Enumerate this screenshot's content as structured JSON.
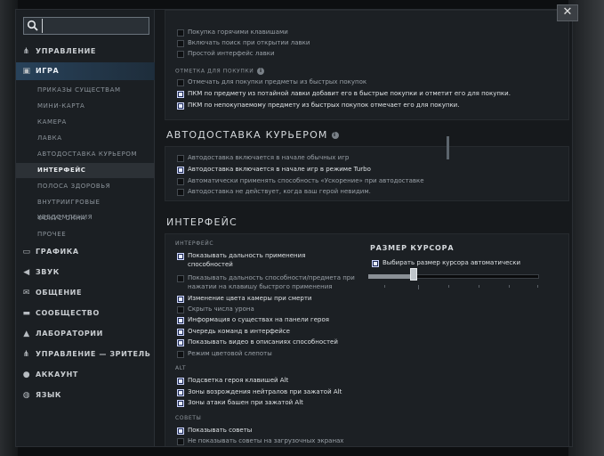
{
  "window": {
    "close_label": "✕"
  },
  "search": {
    "value": "",
    "placeholder": ""
  },
  "sidebar": {
    "categories": [
      {
        "label": "УПРАВЛЕНИЕ",
        "icon": "tree-icon"
      },
      {
        "label": "ИГРА",
        "icon": "game-icon"
      },
      {
        "label": "ГРАФИКА",
        "icon": "monitor-icon"
      },
      {
        "label": "ЗВУК",
        "icon": "speaker-icon"
      },
      {
        "label": "ОБЩЕНИЕ",
        "icon": "chat-icon"
      },
      {
        "label": "СООБЩЕСТВО",
        "icon": "community-icon"
      },
      {
        "label": "ЛАБОРАТОРИИ",
        "icon": "flask-icon"
      },
      {
        "label": "УПРАВЛЕНИЕ — ЗРИТЕЛЬ",
        "icon": "tree-icon"
      },
      {
        "label": "АККАУНТ",
        "icon": "user-icon"
      },
      {
        "label": "ЯЗЫК",
        "icon": "globe-icon"
      }
    ],
    "game_subitems": [
      "ПРИКАЗЫ СУЩЕСТВАМ",
      "МИНИ-КАРТА",
      "КАМЕРА",
      "ЛАВКА",
      "АВТОДОСТАВКА КУРЬЕРОМ",
      "ИНТЕРФЕЙС",
      "ПОЛОСА ЗДОРОВЬЯ",
      "ВНУТРИИГРОВЫЕ УВЕДОМЛЕНИЯ",
      "ФОКУС ОКНА",
      "ПРОЧЕЕ"
    ],
    "active_category": "ИГРА",
    "active_subitem": "ИНТЕРФЕЙС"
  },
  "shop": {
    "options": [
      {
        "label": "Покупка горячими клавишами",
        "checked": false
      },
      {
        "label": "Включать поиск при открытии лавки",
        "checked": false
      },
      {
        "label": "Простой интерфейс лавки",
        "checked": false
      }
    ],
    "buy_mark_header": "ОТМЕТКА ДЛЯ ПОКУПКИ",
    "buy_mark_options": [
      {
        "label": "Отмечать для покупки предметы из быстрых покупок",
        "checked": false
      },
      {
        "label": "ПКМ по предмету из потайной лавки добавит его в быстрые покупки и отметит его для покупки.",
        "checked": true
      },
      {
        "label": "ПКМ по непокупаемому предмету из быстрых покупок отмечает его для покупки.",
        "checked": true
      }
    ]
  },
  "courier": {
    "title": "АВТОДОСТАВКА КУРЬЕРОМ",
    "options": [
      {
        "label": "Автодоставка включается в начале обычных игр",
        "checked": false
      },
      {
        "label": "Автодоставка включается в начале игр в режиме Turbo",
        "checked": true
      },
      {
        "label": "Автоматически применять способность «Ускорение» при автодоставке",
        "checked": false
      },
      {
        "label": "Автодоставка не действует, когда ваш герой невидим.",
        "checked": false
      }
    ]
  },
  "interface": {
    "title": "ИНТЕРФЕЙС",
    "sub_header": "ИНТЕРФЕЙС",
    "options": [
      {
        "label": "Показывать дальность применения способностей",
        "checked": true
      },
      {
        "label": "Показывать дальность способности/предмета при нажатии на клавишу быстрого применения",
        "checked": false
      },
      {
        "label": "Изменение цвета камеры при смерти",
        "checked": true
      },
      {
        "label": "Скрыть числа урона",
        "checked": false
      },
      {
        "label": "Информация о существах на панели героя",
        "checked": true
      },
      {
        "label": "Очередь команд в интерфейсе",
        "checked": true
      },
      {
        "label": "Показывать видео в описаниях способностей",
        "checked": true
      },
      {
        "label": "Режим цветовой слепоты",
        "checked": false
      }
    ],
    "alt_header": "ALT",
    "alt_options": [
      {
        "label": "Подсветка героя клавишей Alt",
        "checked": true
      },
      {
        "label": "Зоны возрождения нейтралов при зажатой Alt",
        "checked": true
      },
      {
        "label": "Зоны атаки башен при зажатой Alt",
        "checked": true
      }
    ],
    "tips_header": "СОВЕТЫ",
    "tips_options": [
      {
        "label": "Показывать советы",
        "checked": true
      },
      {
        "label": "Не показывать советы на загрузочных экранах",
        "checked": false
      }
    ],
    "cursor": {
      "title": "РАЗМЕР КУРСОРА",
      "auto_label": "Выбирать размер курсора автоматически",
      "auto_checked": true,
      "slider_level": 0.25
    }
  },
  "colors": {
    "accent": "#28425a",
    "checkbox_on": "#1d2b55",
    "background": "#16191c"
  }
}
